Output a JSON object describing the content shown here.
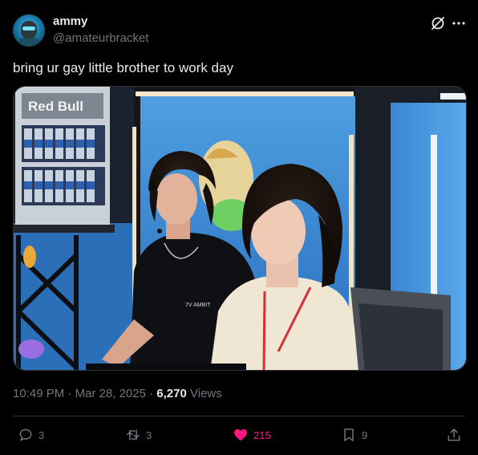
{
  "author": {
    "display_name": "ammy",
    "handle": "@amateurbracket",
    "avatar_icon": "avatar-gamer-icon"
  },
  "header_icons": {
    "grok": "grok-icon",
    "more": "more-icon"
  },
  "tweet": {
    "text": "bring ur gay little brother to work day"
  },
  "media": {
    "fridge_brand": "Red Bull",
    "shirt_print": "7V AMBIT"
  },
  "meta": {
    "time": "10:49 PM",
    "separator": "·",
    "date": "Mar 28, 2025",
    "separator2": "·",
    "views_count": "6,270",
    "views_label": "Views"
  },
  "actions": {
    "reply_count": "3",
    "repost_count": "3",
    "like_count": "215",
    "bookmark_count": "9"
  },
  "colors": {
    "background": "#000000",
    "text_primary": "#e7e9ea",
    "text_secondary": "#71767b",
    "like_active": "#f91880",
    "divider": "#2f3336"
  }
}
